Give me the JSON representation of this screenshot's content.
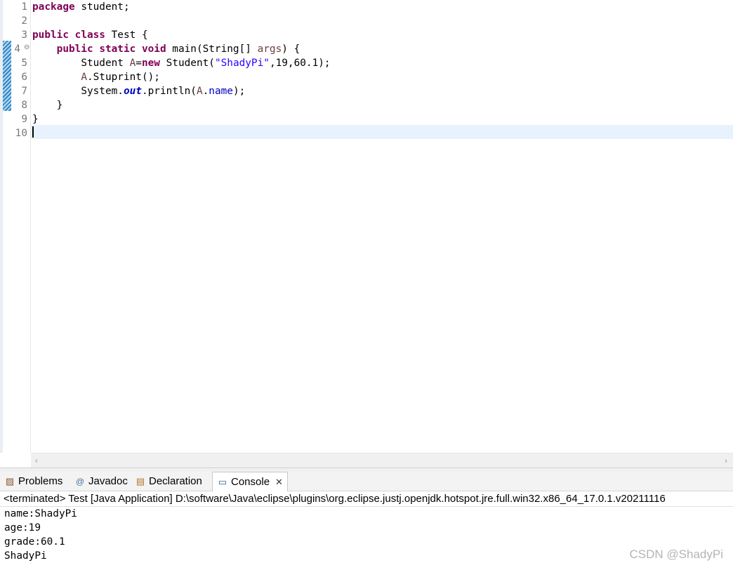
{
  "editor": {
    "line_numbers": [
      "1",
      "2",
      "3",
      "4",
      "5",
      "6",
      "7",
      "8",
      "9",
      "10"
    ],
    "code": {
      "l1": {
        "kw": "package",
        "rest": " student;"
      },
      "l3": {
        "kw1": "public",
        "kw2": "class",
        "rest": " Test {"
      },
      "l4": {
        "indent": "    ",
        "kw1": "public",
        "kw2": "static",
        "kw3": "void",
        "rest": " main(String[] ",
        "param": "args",
        "rest2": ") {"
      },
      "l5": {
        "indent": "        ",
        "a": "Student ",
        "var": "A",
        "eq": "=",
        "kw": "new",
        "b": " Student(",
        "str": "\"ShadyPi\"",
        "c": ",19,60.1);"
      },
      "l6": {
        "indent": "        ",
        "var": "A",
        "rest": ".Stuprint();"
      },
      "l7": {
        "indent": "        ",
        "a": "System.",
        "sfield": "out",
        "b": ".println(",
        "var": "A",
        "dot": ".",
        "field": "name",
        "c": ");"
      },
      "l8": {
        "text": "    }"
      },
      "l9": {
        "text": "}"
      }
    }
  },
  "tabs": [
    {
      "label": "Problems",
      "icon": "problems-icon"
    },
    {
      "label": "Javadoc",
      "icon": "at-icon"
    },
    {
      "label": "Declaration",
      "icon": "declaration-icon"
    },
    {
      "label": "Console",
      "icon": "console-icon"
    }
  ],
  "console": {
    "header": "<terminated> Test [Java Application] D:\\software\\Java\\eclipse\\plugins\\org.eclipse.justj.openjdk.hotspot.jre.full.win32.x86_64_17.0.1.v20211116",
    "output": [
      "name:ShadyPi",
      "age:19",
      "grade:60.1",
      "ShadyPi"
    ]
  },
  "watermark": "CSDN @ShadyPi",
  "colors": {
    "keyword": "#7f0055",
    "string": "#2a00ff",
    "field": "#0000c0",
    "current_line": "#e8f2fe"
  }
}
